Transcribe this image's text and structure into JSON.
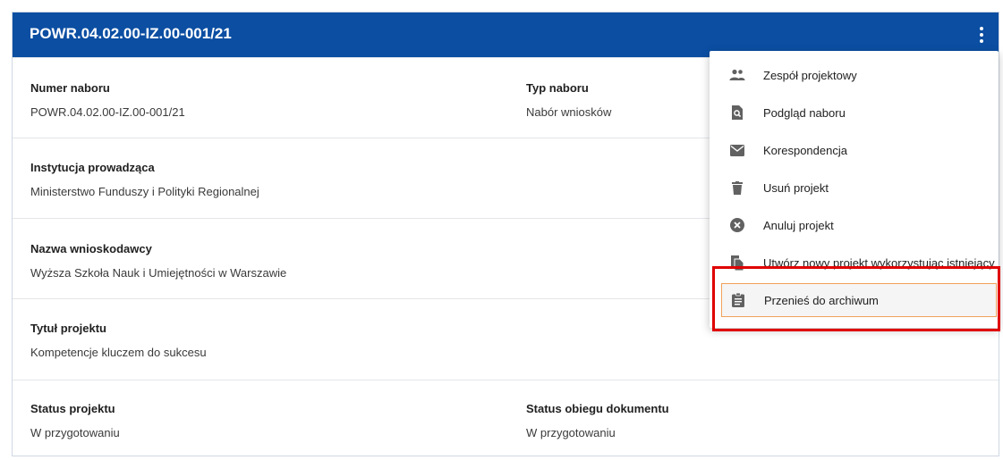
{
  "header": {
    "title": "POWR.04.02.00-IZ.00-001/21"
  },
  "fields": {
    "numer_naboru": {
      "label": "Numer naboru",
      "value": "POWR.04.02.00-IZ.00-001/21"
    },
    "typ_naboru": {
      "label": "Typ naboru",
      "value": "Nabór wniosków"
    },
    "instytucja": {
      "label": "Instytucja prowadząca",
      "value": "Ministerstwo Funduszy i Polityki Regionalnej"
    },
    "wnioskodawca": {
      "label": "Nazwa wnioskodawcy",
      "value": "Wyższa Szkoła Nauk i Umiejętności w Warszawie"
    },
    "tytul": {
      "label": "Tytuł projektu",
      "value": "Kompetencje kluczem do sukcesu"
    },
    "status_projektu": {
      "label": "Status projektu",
      "value": "W przygotowaniu"
    },
    "status_obiegu": {
      "label": "Status obiegu dokumentu",
      "value": "W przygotowaniu"
    }
  },
  "menu": {
    "items": [
      {
        "label": "Zespół projektowy",
        "icon": "group-icon"
      },
      {
        "label": "Podgląd naboru",
        "icon": "find-in-page-icon"
      },
      {
        "label": "Korespondencja",
        "icon": "mail-icon"
      },
      {
        "label": "Usuń projekt",
        "icon": "trash-icon"
      },
      {
        "label": "Anuluj projekt",
        "icon": "cancel-icon"
      },
      {
        "label": "Utwórz nowy projekt wykorzystując istniejący",
        "icon": "file-copy-icon"
      },
      {
        "label": "Przenieś do archiwum",
        "icon": "assignment-icon"
      }
    ]
  },
  "colors": {
    "header": "#0b4ea2",
    "highlight_box": "#e00000",
    "active_item_border": "#f0a15a"
  }
}
